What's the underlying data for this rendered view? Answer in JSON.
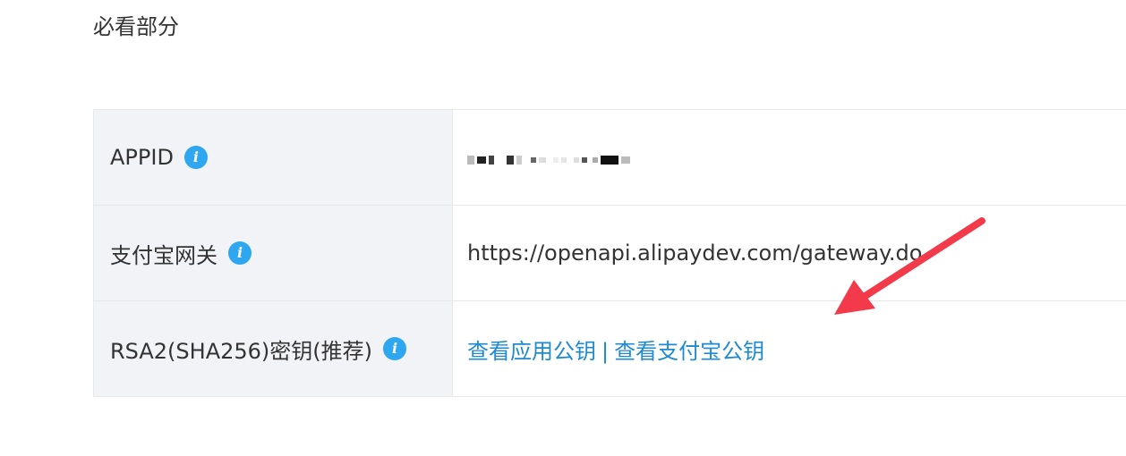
{
  "section": {
    "title": "必看部分"
  },
  "rows": [
    {
      "label": "APPID",
      "value_masked": true
    },
    {
      "label": "支付宝网关",
      "value": "https://openapi.alipaydev.com/gateway.do"
    },
    {
      "label": "RSA2(SHA256)密钥(推荐)",
      "link_app_key": "查看应用公钥",
      "separator": "|",
      "link_alipay_key": "查看支付宝公钥"
    }
  ],
  "icons": {
    "info": "info-icon",
    "arrow": "red-arrow-annotation"
  },
  "colors": {
    "label_bg": "#f2f3f7",
    "border": "#e8e8e8",
    "info_icon": "#2ea6f0",
    "link": "#1f8ad2",
    "arrow": "#f23a4b"
  }
}
